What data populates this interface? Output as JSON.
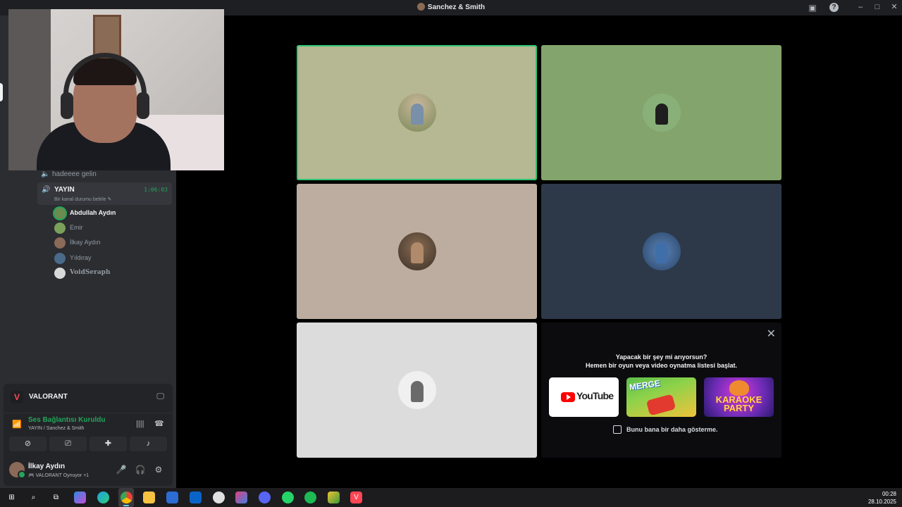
{
  "window": {
    "title": "Sanchez & Smith"
  },
  "channels": {
    "prev_channel": "hadeeee gelin",
    "active": {
      "name": "YAYIN",
      "timer": "1:06:03",
      "status": "Bir kanal durumu belirle"
    },
    "members": [
      {
        "name": "Abdullah Aydın",
        "speaking": true,
        "color": "#6a8c4e"
      },
      {
        "name": "Emir",
        "speaking": false,
        "color": "#7aa05a"
      },
      {
        "name": "İlkay Aydın",
        "speaking": false,
        "color": "#8b6a58"
      },
      {
        "name": "Yıldıray",
        "speaking": false,
        "color": "#4a6a8a"
      },
      {
        "name": "VoidSeraph",
        "speaking": false,
        "color": "#d8d8d8"
      }
    ]
  },
  "activity": {
    "game": "VALORANT",
    "game_icon": "valorant-logo",
    "accent": "#ff4655"
  },
  "voice_status": {
    "title": "Ses Bağlantısı Kuruldu",
    "subtitle": "YAYIN / Sanchez & Smith"
  },
  "user": {
    "name": "İlkay Aydın",
    "status": "🎮 VALORANT Oynuyor +1"
  },
  "tiles": [
    {
      "participant": "Abdullah Aydın",
      "bg": "#b6b793",
      "active": true
    },
    {
      "participant": "Emir",
      "bg": "#83a46c",
      "active": false
    },
    {
      "participant": "İlkay Aydın",
      "bg": "#bcada0",
      "active": false
    },
    {
      "participant": "Yıldıray",
      "bg": "#2d3949",
      "active": false
    },
    {
      "participant": "VoidSeraph",
      "bg": "#dcdcdc",
      "active": false
    }
  ],
  "promo": {
    "line1": "Yapacak bir şey mi arıyorsun?",
    "line2": "Hemen bir oyun veya video oynatma listesi başlat.",
    "youtube_label": "YouTube",
    "merge_label": "MERGE",
    "karaoke_label_1": "KARAOKE",
    "karaoke_label_2": "PARTY",
    "dont_show": "Bunu bana bir daha gösterme."
  },
  "taskbar": {
    "time": "00:28",
    "date": "28.10.2025"
  }
}
